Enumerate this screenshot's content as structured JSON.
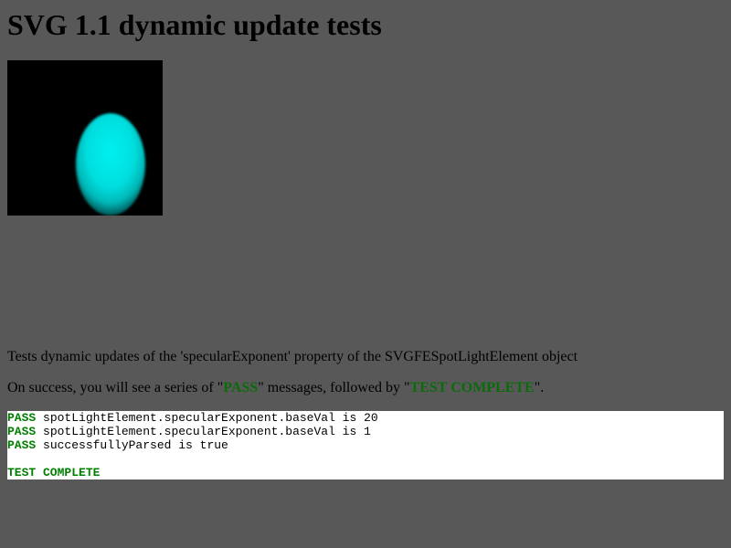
{
  "page": {
    "title": "SVG 1.1 dynamic update tests"
  },
  "description": {
    "line1": "Tests dynamic updates of the 'specularExponent' property of the SVGFESpotLightElement object",
    "line2_prefix": "On success, you will see a series of \"",
    "line2_pass": "PASS",
    "line2_middle": "\" messages, followed by \"",
    "line2_complete": "TEST COMPLETE",
    "line2_suffix": "\"."
  },
  "console": {
    "results": [
      {
        "status": "PASS",
        "message": " spotLightElement.specularExponent.baseVal is 20"
      },
      {
        "status": "PASS",
        "message": " spotLightElement.specularExponent.baseVal is 1"
      },
      {
        "status": "PASS",
        "message": " successfullyParsed is true"
      }
    ],
    "complete": "TEST COMPLETE"
  },
  "colors": {
    "page_background": "#585858",
    "canvas_background": "#000000",
    "lit_ellipse": "#00e5e5",
    "pass_green": "#008000",
    "console_background": "#ffffff"
  }
}
